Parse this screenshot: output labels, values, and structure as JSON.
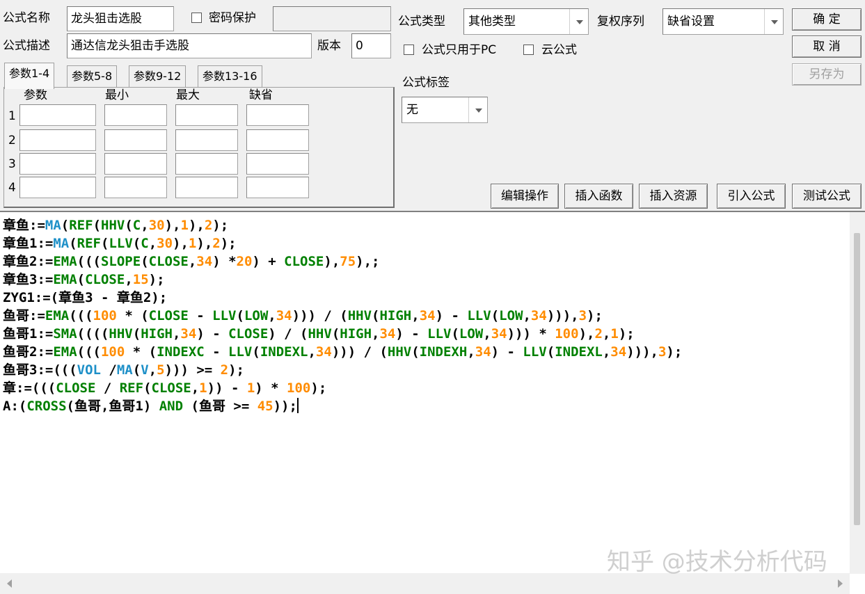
{
  "form": {
    "name_label": "公式名称",
    "name_value": "龙头狙击选股",
    "password_label": "密码保护",
    "password_checked": false,
    "desc_label": "公式描述",
    "desc_value": "通达信龙头狙击手选股",
    "version_label": "版本",
    "version_value": "0",
    "type_label": "公式类型",
    "type_value": "其他类型",
    "rights_label": "复权序列",
    "rights_value": "缺省设置",
    "pc_only_label": "公式只用于PC",
    "pc_only_checked": false,
    "cloud_label": "云公式",
    "cloud_checked": false,
    "tag_label": "公式标签",
    "tag_value": "无"
  },
  "buttons": {
    "ok": "确 定",
    "cancel": "取 消",
    "save_as": "另存为",
    "edit_ops": "编辑操作",
    "insert_func": "插入函数",
    "insert_res": "插入资源",
    "import_formula": "引入公式",
    "test_formula": "测试公式"
  },
  "tabs": [
    {
      "label": "参数1-4",
      "active": true
    },
    {
      "label": "参数5-8",
      "active": false
    },
    {
      "label": "参数9-12",
      "active": false
    },
    {
      "label": "参数13-16",
      "active": false
    }
  ],
  "params": {
    "headers": [
      "参数",
      "最小",
      "最大",
      "缺省"
    ],
    "rows": [
      "1",
      "2",
      "3",
      "4"
    ]
  },
  "colors": {
    "keyword": "#008000",
    "function_blue": "#1e90c8",
    "number": "#ff8c00",
    "default": "#000000"
  },
  "code_lines": [
    [
      [
        "章鱼:=",
        "d"
      ],
      [
        "MA",
        "b"
      ],
      [
        "(",
        "d"
      ],
      [
        "REF",
        "k"
      ],
      [
        "(",
        "d"
      ],
      [
        "HHV",
        "k"
      ],
      [
        "(",
        "d"
      ],
      [
        "C",
        "k"
      ],
      [
        ",",
        "d"
      ],
      [
        "30",
        "n"
      ],
      [
        "),",
        "d"
      ],
      [
        "1",
        "n"
      ],
      [
        "),",
        "d"
      ],
      [
        "2",
        "n"
      ],
      [
        ");",
        "d"
      ]
    ],
    [
      [
        "章鱼1:=",
        "d"
      ],
      [
        "MA",
        "b"
      ],
      [
        "(",
        "d"
      ],
      [
        "REF",
        "k"
      ],
      [
        "(",
        "d"
      ],
      [
        "LLV",
        "k"
      ],
      [
        "(",
        "d"
      ],
      [
        "C",
        "k"
      ],
      [
        ",",
        "d"
      ],
      [
        "30",
        "n"
      ],
      [
        "),",
        "d"
      ],
      [
        "1",
        "n"
      ],
      [
        "),",
        "d"
      ],
      [
        "2",
        "n"
      ],
      [
        ");",
        "d"
      ]
    ],
    [
      [
        "章鱼2:=",
        "d"
      ],
      [
        "EMA",
        "k"
      ],
      [
        "(((",
        "d"
      ],
      [
        "SLOPE",
        "k"
      ],
      [
        "(",
        "d"
      ],
      [
        "CLOSE",
        "k"
      ],
      [
        ",",
        "d"
      ],
      [
        "34",
        "n"
      ],
      [
        ") *",
        "d"
      ],
      [
        "20",
        "n"
      ],
      [
        ") + ",
        "d"
      ],
      [
        "CLOSE",
        "k"
      ],
      [
        "),",
        "d"
      ],
      [
        "75",
        "n"
      ],
      [
        "),;",
        "d"
      ]
    ],
    [
      [
        "章鱼3:=",
        "d"
      ],
      [
        "EMA",
        "k"
      ],
      [
        "(",
        "d"
      ],
      [
        "CLOSE",
        "k"
      ],
      [
        ",",
        "d"
      ],
      [
        "15",
        "n"
      ],
      [
        ");",
        "d"
      ]
    ],
    [
      [
        "ZYG1:=(章鱼3 - 章鱼2);",
        "d"
      ]
    ],
    [
      [
        "鱼哥:=",
        "d"
      ],
      [
        "EMA",
        "k"
      ],
      [
        "(((",
        "d"
      ],
      [
        "100",
        "n"
      ],
      [
        " * (",
        "d"
      ],
      [
        "CLOSE",
        "k"
      ],
      [
        " - ",
        "d"
      ],
      [
        "LLV",
        "k"
      ],
      [
        "(",
        "d"
      ],
      [
        "LOW",
        "k"
      ],
      [
        ",",
        "d"
      ],
      [
        "34",
        "n"
      ],
      [
        "))) / (",
        "d"
      ],
      [
        "HHV",
        "k"
      ],
      [
        "(",
        "d"
      ],
      [
        "HIGH",
        "k"
      ],
      [
        ",",
        "d"
      ],
      [
        "34",
        "n"
      ],
      [
        ") - ",
        "d"
      ],
      [
        "LLV",
        "k"
      ],
      [
        "(",
        "d"
      ],
      [
        "LOW",
        "k"
      ],
      [
        ",",
        "d"
      ],
      [
        "34",
        "n"
      ],
      [
        "))),",
        "d"
      ],
      [
        "3",
        "n"
      ],
      [
        ");",
        "d"
      ]
    ],
    [
      [
        "鱼哥1:=",
        "d"
      ],
      [
        "SMA",
        "k"
      ],
      [
        "((((",
        "d"
      ],
      [
        "HHV",
        "k"
      ],
      [
        "(",
        "d"
      ],
      [
        "HIGH",
        "k"
      ],
      [
        ",",
        "d"
      ],
      [
        "34",
        "n"
      ],
      [
        ") - ",
        "d"
      ],
      [
        "CLOSE",
        "k"
      ],
      [
        ") / (",
        "d"
      ],
      [
        "HHV",
        "k"
      ],
      [
        "(",
        "d"
      ],
      [
        "HIGH",
        "k"
      ],
      [
        ",",
        "d"
      ],
      [
        "34",
        "n"
      ],
      [
        ") - ",
        "d"
      ],
      [
        "LLV",
        "k"
      ],
      [
        "(",
        "d"
      ],
      [
        "LOW",
        "k"
      ],
      [
        ",",
        "d"
      ],
      [
        "34",
        "n"
      ],
      [
        "))) * ",
        "d"
      ],
      [
        "100",
        "n"
      ],
      [
        "),",
        "d"
      ],
      [
        "2",
        "n"
      ],
      [
        ",",
        "d"
      ],
      [
        "1",
        "n"
      ],
      [
        ");",
        "d"
      ]
    ],
    [
      [
        "鱼哥2:=",
        "d"
      ],
      [
        "EMA",
        "k"
      ],
      [
        "(((",
        "d"
      ],
      [
        "100",
        "n"
      ],
      [
        " * (",
        "d"
      ],
      [
        "INDEXC",
        "k"
      ],
      [
        " - ",
        "d"
      ],
      [
        "LLV",
        "k"
      ],
      [
        "(",
        "d"
      ],
      [
        "INDEXL",
        "k"
      ],
      [
        ",",
        "d"
      ],
      [
        "34",
        "n"
      ],
      [
        "))) / (",
        "d"
      ],
      [
        "HHV",
        "k"
      ],
      [
        "(",
        "d"
      ],
      [
        "INDEXH",
        "k"
      ],
      [
        ",",
        "d"
      ],
      [
        "34",
        "n"
      ],
      [
        ") - ",
        "d"
      ],
      [
        "LLV",
        "k"
      ],
      [
        "(",
        "d"
      ],
      [
        "INDEXL",
        "k"
      ],
      [
        ",",
        "d"
      ],
      [
        "34",
        "n"
      ],
      [
        "))),",
        "d"
      ],
      [
        "3",
        "n"
      ],
      [
        ");",
        "d"
      ]
    ],
    [
      [
        "鱼哥3:=(((",
        "d"
      ],
      [
        "VOL",
        "b"
      ],
      [
        " /",
        "d"
      ],
      [
        "MA",
        "b"
      ],
      [
        "(",
        "d"
      ],
      [
        "V",
        "b"
      ],
      [
        ",",
        "d"
      ],
      [
        "5",
        "n"
      ],
      [
        "))) >= ",
        "d"
      ],
      [
        "2",
        "n"
      ],
      [
        ");",
        "d"
      ]
    ],
    [
      [
        "章:=(((",
        "d"
      ],
      [
        "CLOSE",
        "k"
      ],
      [
        " / ",
        "d"
      ],
      [
        "REF",
        "k"
      ],
      [
        "(",
        "d"
      ],
      [
        "CLOSE",
        "k"
      ],
      [
        ",",
        "d"
      ],
      [
        "1",
        "n"
      ],
      [
        ")) - ",
        "d"
      ],
      [
        "1",
        "n"
      ],
      [
        ") * ",
        "d"
      ],
      [
        "100",
        "n"
      ],
      [
        ");",
        "d"
      ]
    ],
    [
      [
        "A:(",
        "d"
      ],
      [
        "CROSS",
        "k"
      ],
      [
        "(鱼哥,鱼哥1) ",
        "d"
      ],
      [
        "AND",
        "k"
      ],
      [
        " (鱼哥 >= ",
        "d"
      ],
      [
        "45",
        "n"
      ],
      [
        "));",
        "d"
      ]
    ]
  ],
  "watermark": "知乎 @技术分析代码"
}
